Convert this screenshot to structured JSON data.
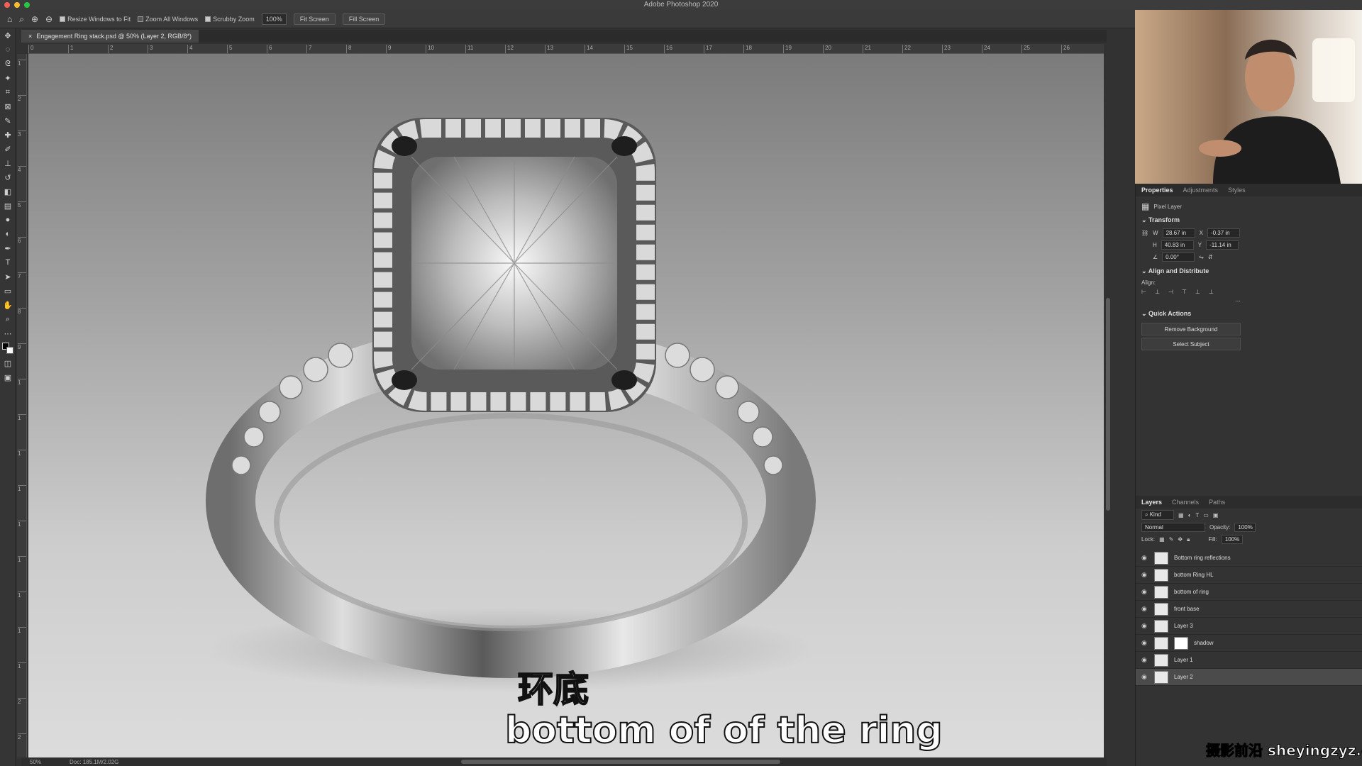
{
  "app": {
    "title": "Adobe Photoshop 2020"
  },
  "options": {
    "zoom_tool": "zoom-icon",
    "resize_windows": "Resize Windows to Fit",
    "zoom_all": "Zoom All Windows",
    "scrubby": "Scrubby Zoom",
    "zoom_value": "100%",
    "fit_screen": "Fit Screen",
    "fill_screen": "Fill Screen"
  },
  "document": {
    "tab": "Engagement Ring stack.psd @ 50% (Layer 2, RGB/8*)"
  },
  "ruler": {
    "h": [
      "0",
      "1",
      "2",
      "3",
      "4",
      "5",
      "6",
      "7",
      "8",
      "9",
      "10",
      "11",
      "12",
      "13",
      "14",
      "15",
      "16",
      "17",
      "18",
      "19",
      "20",
      "21",
      "22",
      "23",
      "24",
      "25",
      "26"
    ],
    "v": [
      "1",
      "2",
      "3",
      "4",
      "5",
      "6",
      "7",
      "8",
      "9",
      "1",
      "1",
      "1",
      "1",
      "1",
      "1",
      "1",
      "1",
      "1",
      "2",
      "2"
    ]
  },
  "subtitles": {
    "zh": "环底",
    "en": "bottom of of the ring"
  },
  "status": {
    "zoom": "50%",
    "doc": "Doc: 185.1M/2.02G"
  },
  "properties": {
    "tabs": [
      "Properties",
      "Adjustments",
      "Styles"
    ],
    "kind": "Pixel Layer",
    "transform_title": "Transform",
    "w_label": "W",
    "w": "28.67 in",
    "x_label": "X",
    "x": "-0.37 in",
    "h_label": "H",
    "h": "40.83 in",
    "y_label": "Y",
    "y": "-11.14 in",
    "angle": "0.00°",
    "align_title": "Align and Distribute",
    "align_label": "Align:",
    "quick_title": "Quick Actions",
    "remove_bg": "Remove Background",
    "select_subject": "Select Subject"
  },
  "layers_panel": {
    "tabs": [
      "Layers",
      "Channels",
      "Paths"
    ],
    "filter": "Kind",
    "blend": "Normal",
    "opacity_label": "Opacity:",
    "opacity": "100%",
    "lock_label": "Lock:",
    "fill_label": "Fill:",
    "fill": "100%",
    "items": [
      {
        "name": "Bottom ring reflections"
      },
      {
        "name": "bottom Ring HL"
      },
      {
        "name": "bottom of ring"
      },
      {
        "name": "front base"
      },
      {
        "name": "Layer 3"
      },
      {
        "name": "shadow"
      },
      {
        "name": "Layer 1"
      },
      {
        "name": "Layer 2"
      }
    ]
  },
  "watermark": "摄影前沿 sheyingzyz.com"
}
